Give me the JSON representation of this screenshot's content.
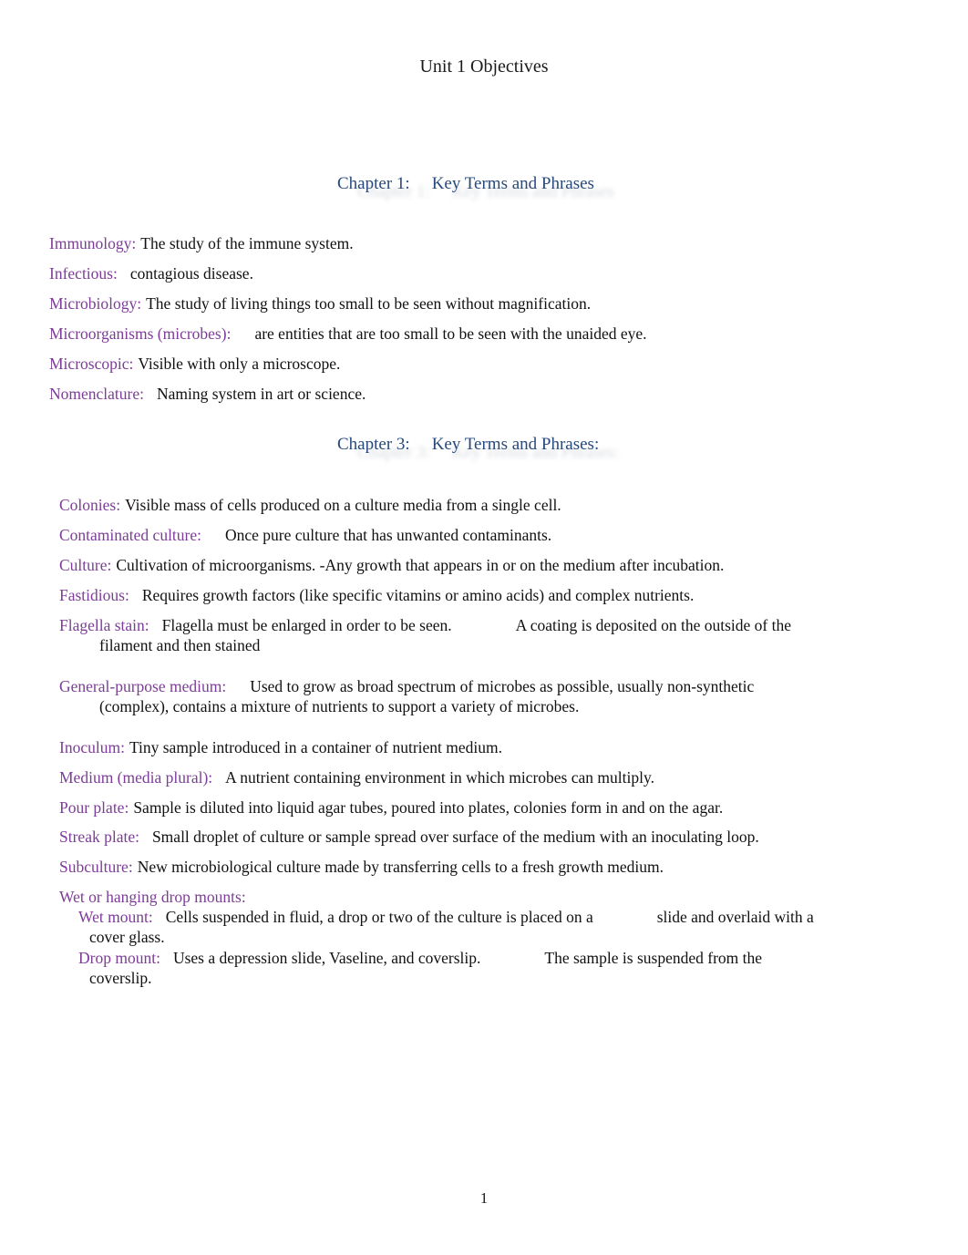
{
  "document": {
    "title": "Unit 1 Objectives",
    "page_number": "1",
    "colors": {
      "heading": "#27497c",
      "term": "#7d3c98",
      "body": "#111111",
      "background": "#ffffff"
    }
  },
  "chapter1": {
    "label": "Chapter 1:",
    "heading": "Key Terms and Phrases",
    "entries": [
      {
        "term": "Immunology:",
        "definition": "The study of the immune system."
      },
      {
        "term": "Infectious:",
        "definition": "contagious disease."
      },
      {
        "term": "Microbiology:",
        "definition": "The study of living things too small to be seen without magnification."
      },
      {
        "term": "Microorganisms (microbes):",
        "definition": "are entities that are too small to be seen with the unaided eye."
      },
      {
        "term": "Microscopic:",
        "definition": "Visible with only a microscope."
      },
      {
        "term": "Nomenclature:",
        "definition": "Naming system in art or science."
      }
    ]
  },
  "chapter3": {
    "label": "Chapter 3:",
    "heading": "Key Terms and Phrases:",
    "entries": [
      {
        "term": "Colonies:",
        "definition": "Visible mass of cells produced on a culture media from a single cell."
      },
      {
        "term": "Contaminated culture:",
        "definition": "Once pure culture that has unwanted contaminants."
      },
      {
        "term": "Culture:",
        "definition": "Cultivation of microorganisms. -Any growth that appears in or on the medium after incubation."
      },
      {
        "term": "Fastidious:",
        "definition": "Requires growth factors (like specific vitamins or amino acids) and complex nutrients."
      },
      {
        "term": "Flagella stain:",
        "definition": "Flagella must be enlarged in order to be seen.",
        "definition2": "A coating is deposited on the outside of the",
        "continuation": "filament and then stained"
      },
      {
        "term": "General-purpose medium:",
        "definition": "Used to grow as broad spectrum of microbes as possible, usually non-synthetic",
        "continuation": "(complex), contains a mixture of nutrients to support a variety of microbes."
      },
      {
        "term": "Inoculum:",
        "definition": "Tiny sample introduced in a container of nutrient medium."
      },
      {
        "term": "Medium (media plural):",
        "definition": "A nutrient containing environment in which microbes can multiply."
      },
      {
        "term": "Pour plate:",
        "definition": "Sample is diluted into liquid agar tubes, poured into plates, colonies form in and on the agar."
      },
      {
        "term": "Streak plate:",
        "definition": "Small droplet of culture or sample spread over surface of the medium with an inoculating loop."
      },
      {
        "term": "Subculture:",
        "definition": "New microbiological culture made by transferring cells to a fresh growth medium."
      }
    ],
    "mounts": {
      "term": "Wet or hanging drop mounts:",
      "items": [
        {
          "term": "Wet mount:",
          "definition": "Cells suspended in fluid, a drop or two of the culture is placed on a",
          "definition2": "slide and overlaid with a",
          "continuation": "cover glass."
        },
        {
          "term": "Drop mount:",
          "definition": "Uses a depression slide, Vaseline, and coverslip.",
          "definition2": "The sample is suspended from the",
          "continuation": "coverslip."
        }
      ]
    }
  }
}
